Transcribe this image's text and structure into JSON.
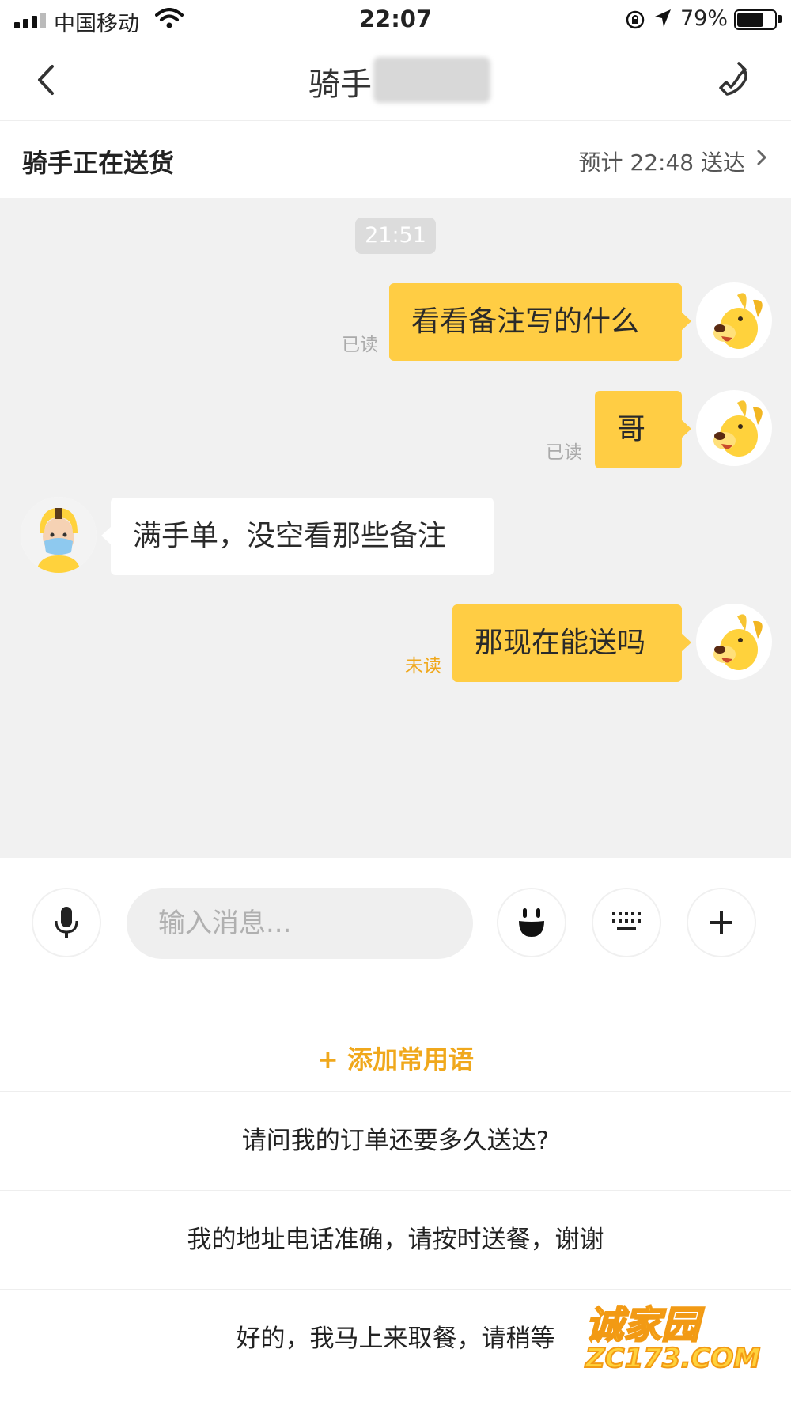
{
  "status_bar": {
    "carrier": "中国移动",
    "time": "22:07",
    "battery_pct": "79%",
    "battery_level": 0.79
  },
  "nav": {
    "title": "骑手"
  },
  "delivery": {
    "status": "骑手正在送货",
    "eta": "预计 22:48 送达"
  },
  "chat": {
    "timestamp": "21:51",
    "messages": [
      {
        "side": "out",
        "text": "看看备注写的什么",
        "status": "已读"
      },
      {
        "side": "out",
        "text": "哥",
        "status": "已读"
      },
      {
        "side": "in",
        "text": "满手单，没空看那些备注"
      },
      {
        "side": "out",
        "text": "那现在能送吗",
        "status": "未读"
      }
    ]
  },
  "input": {
    "placeholder": "输入消息..."
  },
  "quick_replies": {
    "add_label": "+ 添加常用语",
    "items": [
      "请问我的订单还要多久送达?",
      "我的地址电话准确，请按时送餐，谢谢",
      "好的，我马上来取餐，请稍等"
    ]
  },
  "watermark": {
    "line1": "诚家园",
    "line2": "ZC173.COM"
  },
  "colors": {
    "accent": "#ffcd44",
    "accent_text": "#f0a81c",
    "chat_bg": "#f1f1f1"
  }
}
